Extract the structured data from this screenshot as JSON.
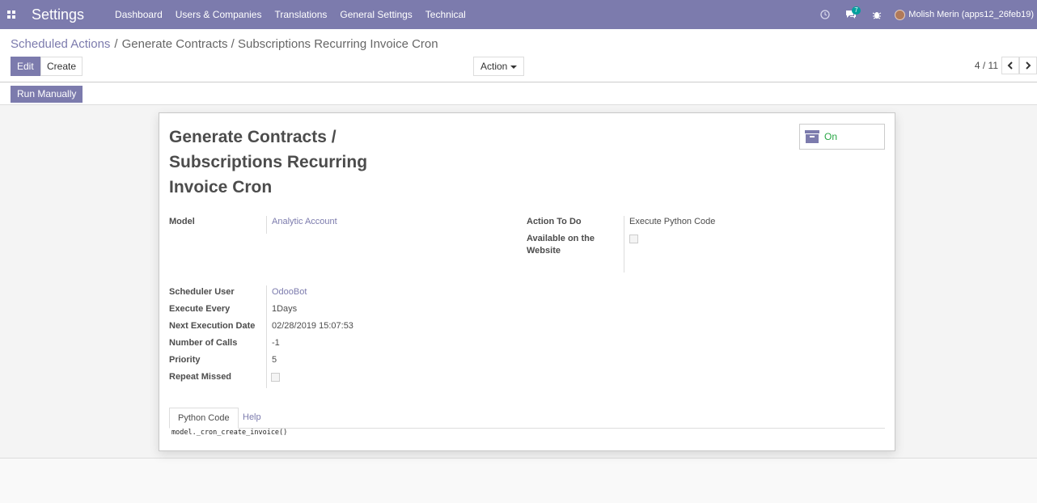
{
  "navbar": {
    "brand": "Settings",
    "menu": [
      "Dashboard",
      "Users & Companies",
      "Translations",
      "General Settings",
      "Technical"
    ],
    "messages_badge": "7",
    "user": "Molish Merin (apps12_26feb19)"
  },
  "breadcrumb": {
    "parent": "Scheduled Actions",
    "separator": "/",
    "current": "Generate Contracts / Subscriptions Recurring Invoice Cron"
  },
  "buttons": {
    "edit": "Edit",
    "create": "Create",
    "action": "Action",
    "run_manually": "Run Manually"
  },
  "pager": {
    "value": "4 / 11"
  },
  "record": {
    "title": "Generate Contracts / Subscriptions Recurring Invoice Cron",
    "active_label": "On",
    "fields": {
      "model": {
        "label": "Model",
        "value": "Analytic Account"
      },
      "action_to_do": {
        "label": "Action To Do",
        "value": "Execute Python Code"
      },
      "available_on_website": {
        "label": "Available on the Website"
      },
      "scheduler_user": {
        "label": "Scheduler User",
        "value": "OdooBot"
      },
      "execute_every": {
        "label": "Execute Every",
        "value": "1Days"
      },
      "next_execution_date": {
        "label": "Next Execution Date",
        "value": "02/28/2019 15:07:53"
      },
      "number_of_calls": {
        "label": "Number of Calls",
        "value": "-1"
      },
      "priority": {
        "label": "Priority",
        "value": "5"
      },
      "repeat_missed": {
        "label": "Repeat Missed"
      }
    },
    "tabs": [
      "Python Code",
      "Help"
    ],
    "code": "model._cron_create_invoice()"
  },
  "colors": {
    "brand": "#7c7bad",
    "active": "#28a745",
    "badge": "#00a09d"
  }
}
